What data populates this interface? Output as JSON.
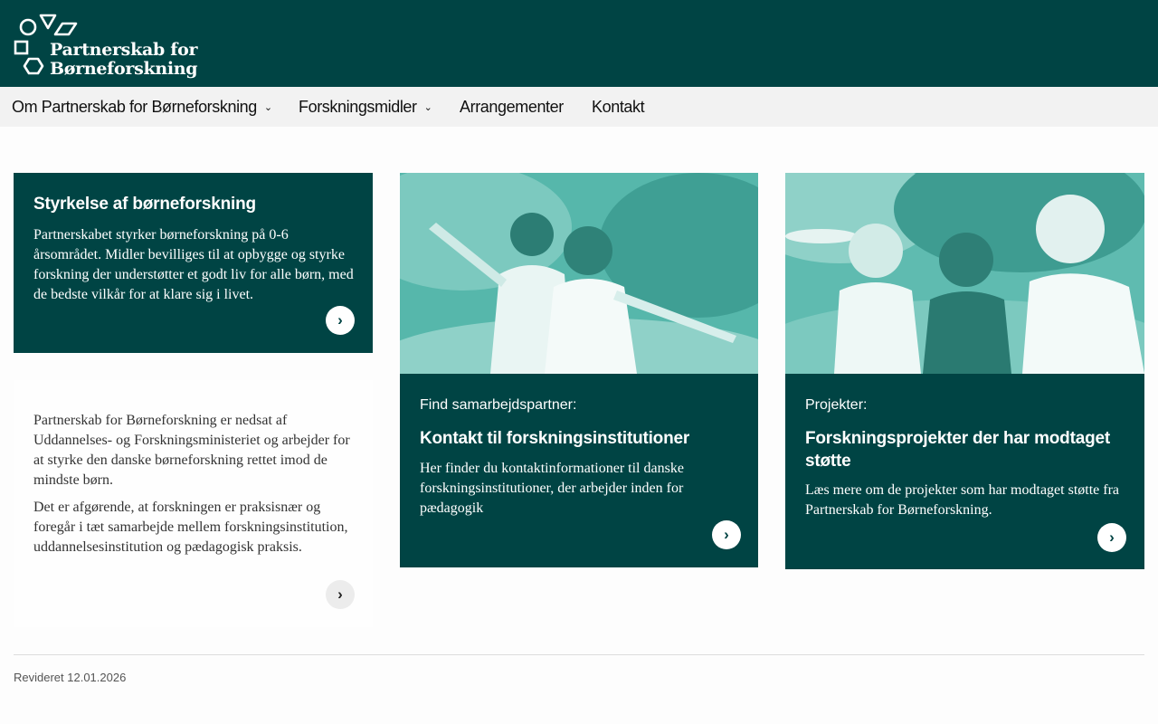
{
  "header": {
    "logo_line1": "Partnerskab for",
    "logo_line2": "Børneforskning"
  },
  "nav": {
    "items": [
      {
        "label": "Om Partnerskab for Børneforskning",
        "dropdown": true
      },
      {
        "label": "Forskningsmidler",
        "dropdown": true
      },
      {
        "label": "Arrangementer",
        "dropdown": false
      },
      {
        "label": "Kontakt",
        "dropdown": false
      }
    ]
  },
  "cards": {
    "intro": {
      "title": "Styrkelse af børneforskning",
      "text": "Partnerskabet styrker børneforskning på 0-6 årsområdet. Midler bevilliges til at opbygge og styrke forskning der understøtter et godt liv for alle børn, med de bedste vilkår for at klare sig i livet."
    },
    "about": {
      "p1": "Partnerskab for Børneforskning er nedsat af Uddannelses- og Forskningsministeriet og arbejder for at styrke den danske børneforskning rettet imod de mindste børn.",
      "p2": "Det er afgørende, at forskningen er praksisnær og foregår i tæt samarbejde mellem forskningsinstitution, uddannelsesinstitution og pædagogisk praksis."
    },
    "partner": {
      "kicker": "Find samarbejdspartner:",
      "title": "Kontakt til forskningsinstitutioner",
      "text": "Her finder du kontaktinformationer til danske forskningsinstitutioner, der arbejder inden for pædagogik"
    },
    "projects": {
      "kicker": "Projekter:",
      "title": "Forskningsprojekter der har modtaget støtte",
      "text": "Læs mere om de projekter som har modtaget støtte fra Partnerskab for Børneforskning."
    }
  },
  "footer": {
    "revised": "Revideret 12.01.2026"
  },
  "icons": {
    "arrow": "›",
    "chevron": "⌄"
  },
  "colors": {
    "primary": "#004444",
    "nav_bg": "#f2f2f2",
    "teal_image": "#4fb3a7"
  }
}
